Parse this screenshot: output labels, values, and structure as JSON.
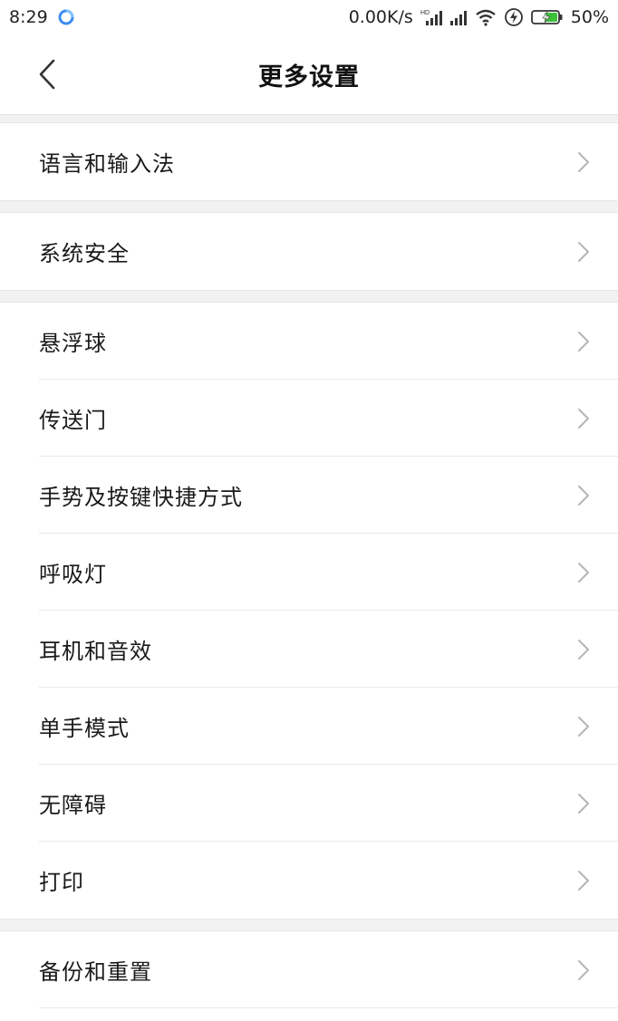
{
  "status_bar": {
    "time": "8:29",
    "net_speed": "0.00K/s",
    "battery_percent": "50%",
    "icons": [
      "browser-app-icon",
      "hd-signal-icon",
      "signal-icon",
      "wifi-icon",
      "flash-icon",
      "battery-charging-icon"
    ]
  },
  "header": {
    "title": "更多设置",
    "back_icon": "chevron-left-icon"
  },
  "sections": [
    {
      "items": [
        {
          "label": "语言和输入法"
        }
      ]
    },
    {
      "items": [
        {
          "label": "系统安全"
        }
      ]
    },
    {
      "items": [
        {
          "label": "悬浮球"
        },
        {
          "label": "传送门"
        },
        {
          "label": "手势及按键快捷方式"
        },
        {
          "label": "呼吸灯"
        },
        {
          "label": "耳机和音效"
        },
        {
          "label": "单手模式"
        },
        {
          "label": "无障碍"
        },
        {
          "label": "打印"
        }
      ]
    },
    {
      "items": [
        {
          "label": "备份和重置"
        }
      ]
    }
  ],
  "colors": {
    "background": "#ffffff",
    "section_gap": "#f2f2f2",
    "divider": "#e8e8e8",
    "chevron": "#b5b5b5",
    "battery_accent": "#3cc13b"
  }
}
